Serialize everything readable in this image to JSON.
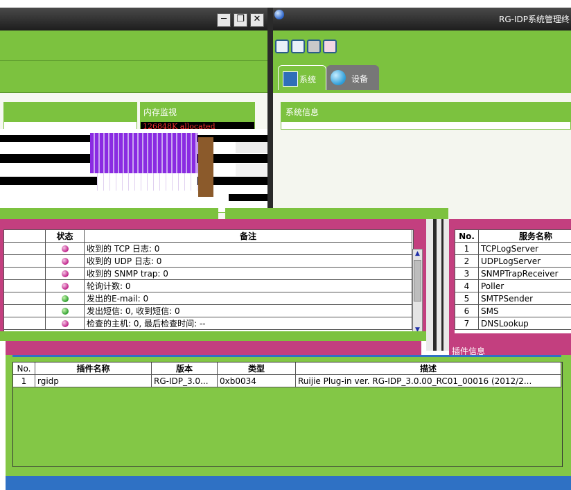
{
  "left_window": {
    "controls": {
      "minimize": "─",
      "restore": "❐",
      "close": "✕"
    }
  },
  "memory_panel": {
    "title": "内存监视",
    "allocated": "126848K allocated"
  },
  "right_window": {
    "title": "RG-IDP系统管理终",
    "tabs": [
      {
        "label": "系统"
      },
      {
        "label": "设备"
      }
    ],
    "system_info": {
      "title": "系统信息"
    }
  },
  "status_table": {
    "columns": [
      "状态",
      "备注"
    ],
    "rows": [
      {
        "status": "pink",
        "note": "收到的 TCP 日志: 0"
      },
      {
        "status": "pink",
        "note": "收到的 UDP 日志: 0"
      },
      {
        "status": "pink",
        "note": "收到的 SNMP trap: 0"
      },
      {
        "status": "pink",
        "note": "轮询计数: 0"
      },
      {
        "status": "green",
        "note": "发出的E-mail: 0"
      },
      {
        "status": "green",
        "note": "发出短信: 0, 收到短信: 0"
      },
      {
        "status": "pink",
        "note": "检查的主机: 0, 最后检查时间: --"
      }
    ]
  },
  "service_table": {
    "columns": [
      "No.",
      "服务名称"
    ],
    "rows": [
      {
        "no": "1",
        "name": "TCPLogServer"
      },
      {
        "no": "2",
        "name": "UDPLogServer"
      },
      {
        "no": "3",
        "name": "SNMPTrapReceiver"
      },
      {
        "no": "4",
        "name": "Poller"
      },
      {
        "no": "5",
        "name": "SMTPSender"
      },
      {
        "no": "6",
        "name": "SMS"
      },
      {
        "no": "7",
        "name": "DNSLookup"
      }
    ]
  },
  "plugin_info": {
    "title": "插件信息"
  },
  "plugin_table": {
    "columns": [
      "No.",
      "插件名称",
      "版本",
      "类型",
      "描述"
    ],
    "rows": [
      {
        "no": "1",
        "name": "rgidp",
        "version": "RG-IDP_3.0...",
        "type": "0xb0034",
        "desc": "Ruijie Plug-in ver. RG-IDP_3.0.00_RC01_00016 (2012/2..."
      }
    ]
  },
  "colors": {
    "green": "#7cc23f",
    "magenta": "#c33f7f",
    "blue": "#2f71c4",
    "dark": "#2a2a2a"
  }
}
